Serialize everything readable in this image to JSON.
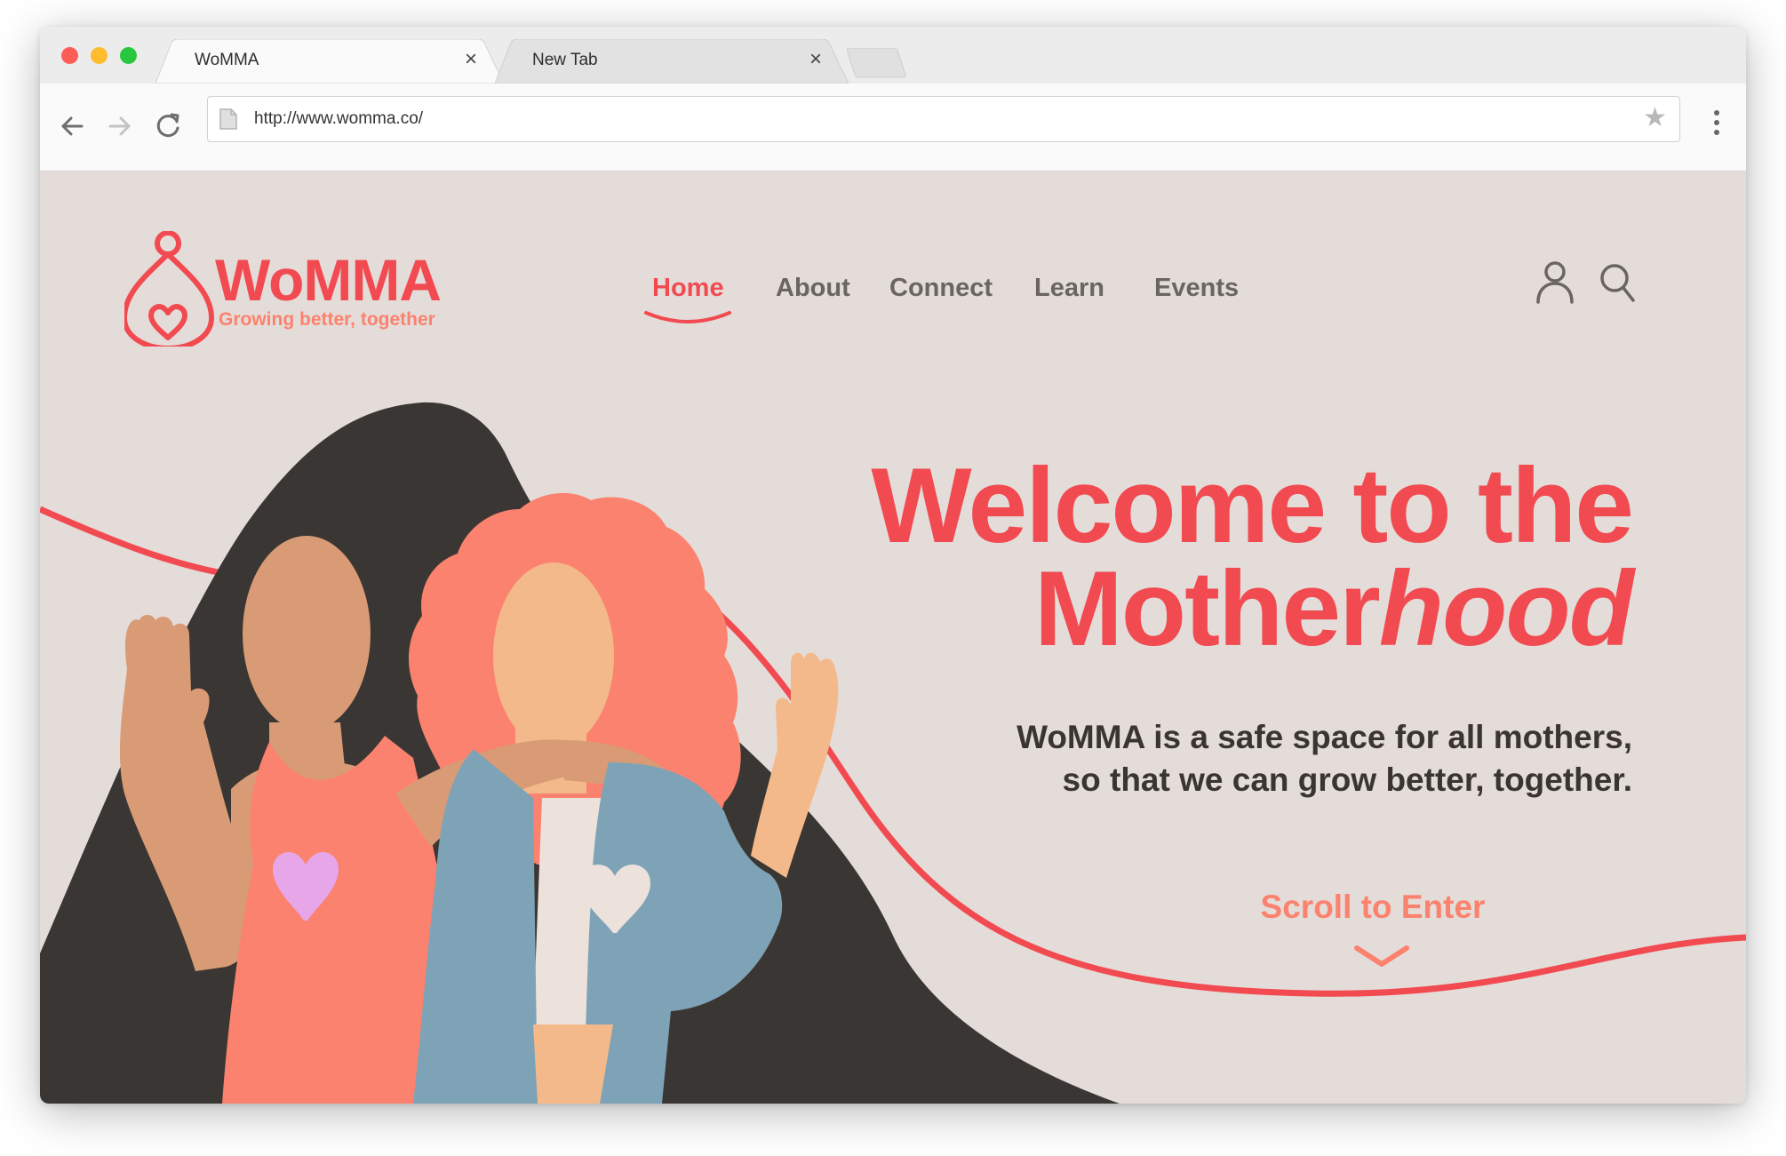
{
  "browser": {
    "tabs": [
      {
        "title": "WoMMA",
        "close": "×"
      },
      {
        "title": "New Tab",
        "close": "×"
      }
    ],
    "url": "http://www.womma.co/",
    "traffic_light_colors": {
      "close": "#fd5d57",
      "minimize": "#febc2e",
      "maximize": "#27c840"
    }
  },
  "site": {
    "logo": {
      "name": "WoMMA",
      "tagline": "Growing better, together"
    },
    "nav": {
      "home": "Home",
      "about": "About",
      "connect": "Connect",
      "learn": "Learn",
      "events": "Events"
    },
    "active_nav": "Home",
    "icons": [
      "user-icon",
      "search-icon"
    ]
  },
  "hero": {
    "title_line1": "Welcome to the",
    "title_line2_regular": "Mother",
    "title_line2_italic": "hood",
    "subtitle_line1": "WoMMA is a safe space for all mothers,",
    "subtitle_line2": "so that we can grow better, together.",
    "scroll_label": "Scroll to Enter"
  },
  "colors": {
    "brand_red": "#f14a50",
    "coral": "#fb826e",
    "background": "#e4dcd9",
    "text_dark": "#3a3532",
    "nav_gray": "#6a6563"
  }
}
